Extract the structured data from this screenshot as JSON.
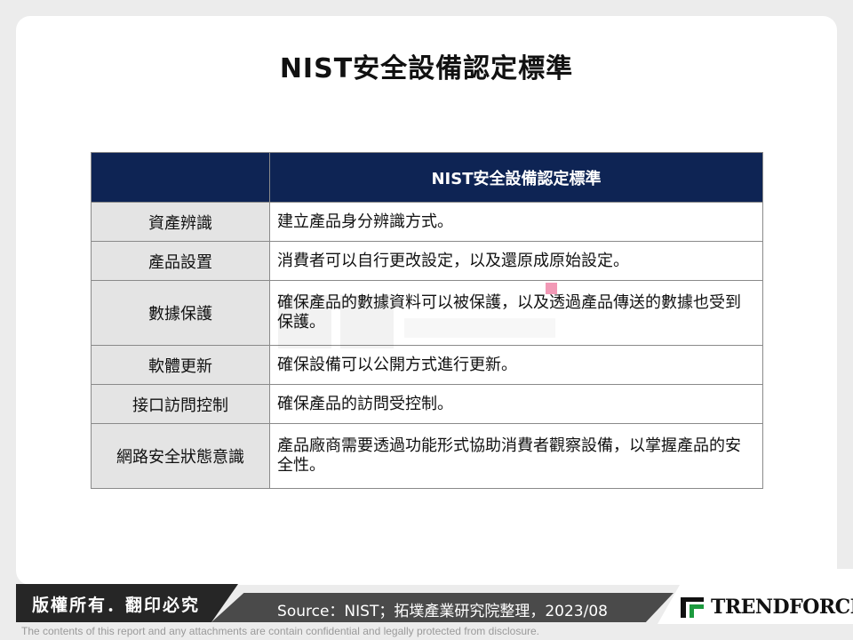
{
  "title": "NIST安全設備認定標準",
  "table": {
    "header": [
      "",
      "NIST安全設備認定標準"
    ],
    "rows": [
      {
        "category": "資產辨識",
        "description": "建立產品身分辨識方式。"
      },
      {
        "category": "產品設置",
        "description": "消費者可以自行更改設定，以及還原成原始設定。"
      },
      {
        "category": "數據保護",
        "description": "確保產品的數據資料可以被保護，以及透過產品傳送的數據也受到保護。"
      },
      {
        "category": "軟體更新",
        "description": "確保設備可以公開方式進行更新。"
      },
      {
        "category": "接口訪問控制",
        "description": "確保產品的訪問受控制。"
      },
      {
        "category": "網路安全狀態意識",
        "description": "產品廠商需要透過功能形式協助消費者觀察設備，以掌握產品的安全性。"
      }
    ]
  },
  "footer": {
    "copyright": "版權所有．翻印必究",
    "source": "Source：NIST；拓墣產業研究院整理，2023/08",
    "brand": "TRENDFORCE",
    "disclaimer": "The contents of this report and any attachments are contain confidential and legally protected from disclosure."
  },
  "colors": {
    "header_bg": "#0e2454",
    "category_bg": "#e4e4e4",
    "brand_green": "#1c9a3e"
  }
}
